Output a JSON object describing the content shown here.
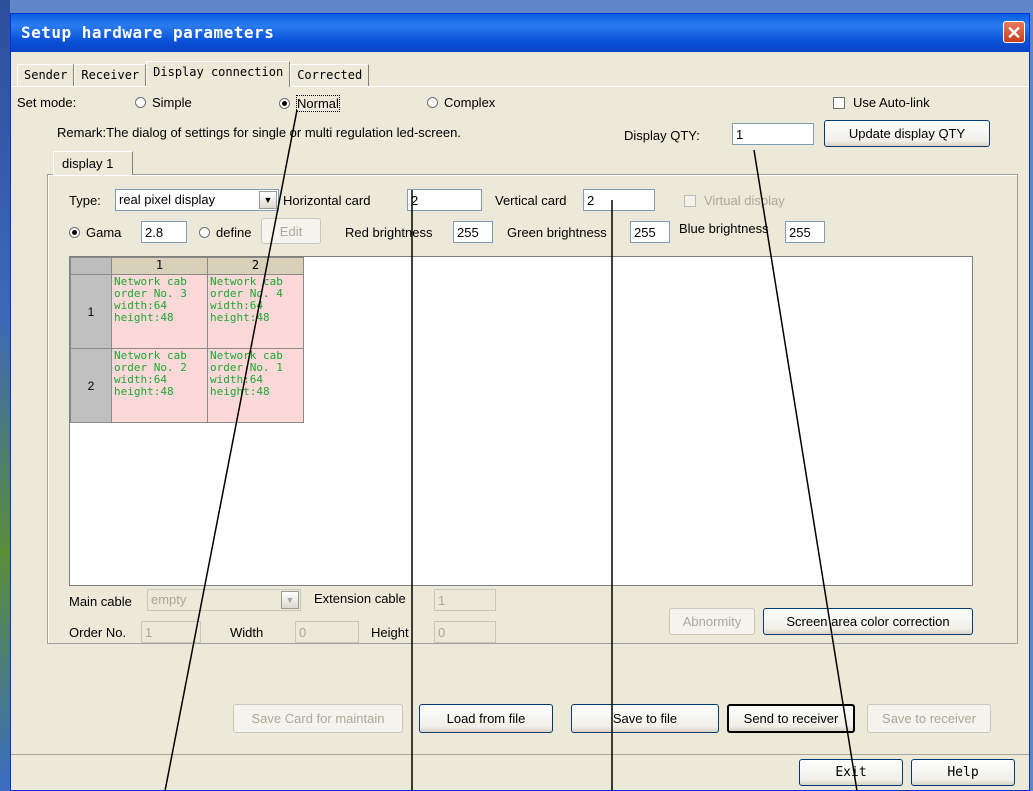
{
  "window": {
    "title": "Setup hardware parameters",
    "close_symbol": "✕"
  },
  "tabs": [
    "Sender",
    "Receiver",
    "Display connection",
    "Corrected"
  ],
  "set_mode": {
    "label": "Set mode:",
    "options": [
      "Simple",
      "Normal",
      "Complex"
    ],
    "selected": "Normal"
  },
  "auto_link": {
    "label": "Use Auto-link",
    "checked": false
  },
  "remark": "Remark:The dialog of settings for single or multi  regulation led-screen.",
  "display_qty": {
    "label": "Display QTY:",
    "value": "1",
    "update_button": "Update display QTY"
  },
  "display_tab": "display 1",
  "type_row": {
    "type_label": "Type:",
    "type_value": "real pixel display",
    "horizontal_label": "Horizontal card",
    "horizontal_value": "2",
    "vertical_label": "Vertical card",
    "vertical_value": "2",
    "virtual_label": "Virtual display"
  },
  "gamma_row": {
    "gama_label": "Gama",
    "gama_value": "2.8",
    "define_label": "define",
    "edit_button": "Edit",
    "red_label": "Red brightness",
    "red_value": "255",
    "green_label": "Green brightness",
    "green_value": "255",
    "blue_label": "Blue brightness",
    "blue_value": "255"
  },
  "grid": {
    "columns": [
      "1",
      "2"
    ],
    "rows": [
      {
        "label": "1",
        "cells": [
          [
            "Network cab",
            "order No. 3",
            "width:64",
            "height:48"
          ],
          [
            "Network cab",
            "order No. 4",
            "width:64",
            "height:48"
          ]
        ]
      },
      {
        "label": "2",
        "cells": [
          [
            "Network cab",
            "order No. 2",
            "width:64",
            "height:48"
          ],
          [
            "Network cab",
            "order No. 1",
            "width:64",
            "height:48"
          ]
        ]
      }
    ]
  },
  "cable_row": {
    "main_label": "Main cable",
    "main_value": "empty",
    "ext_label": "Extension cable",
    "ext_value": "1"
  },
  "order_row": {
    "order_label": "Order No.",
    "order_value": "1",
    "width_label": "Width",
    "width_value": "0",
    "height_label": "Height",
    "height_value": "0",
    "abnormity_button": "Abnormity",
    "correction_button": "Screen area color correction"
  },
  "actions": {
    "save_card": "Save Card for maintain",
    "load": "Load from file",
    "save_file": "Save to file",
    "send": "Send to receiver",
    "save_receiver": "Save to receiver"
  },
  "footer": {
    "exit": "Exit",
    "help": "Help"
  }
}
